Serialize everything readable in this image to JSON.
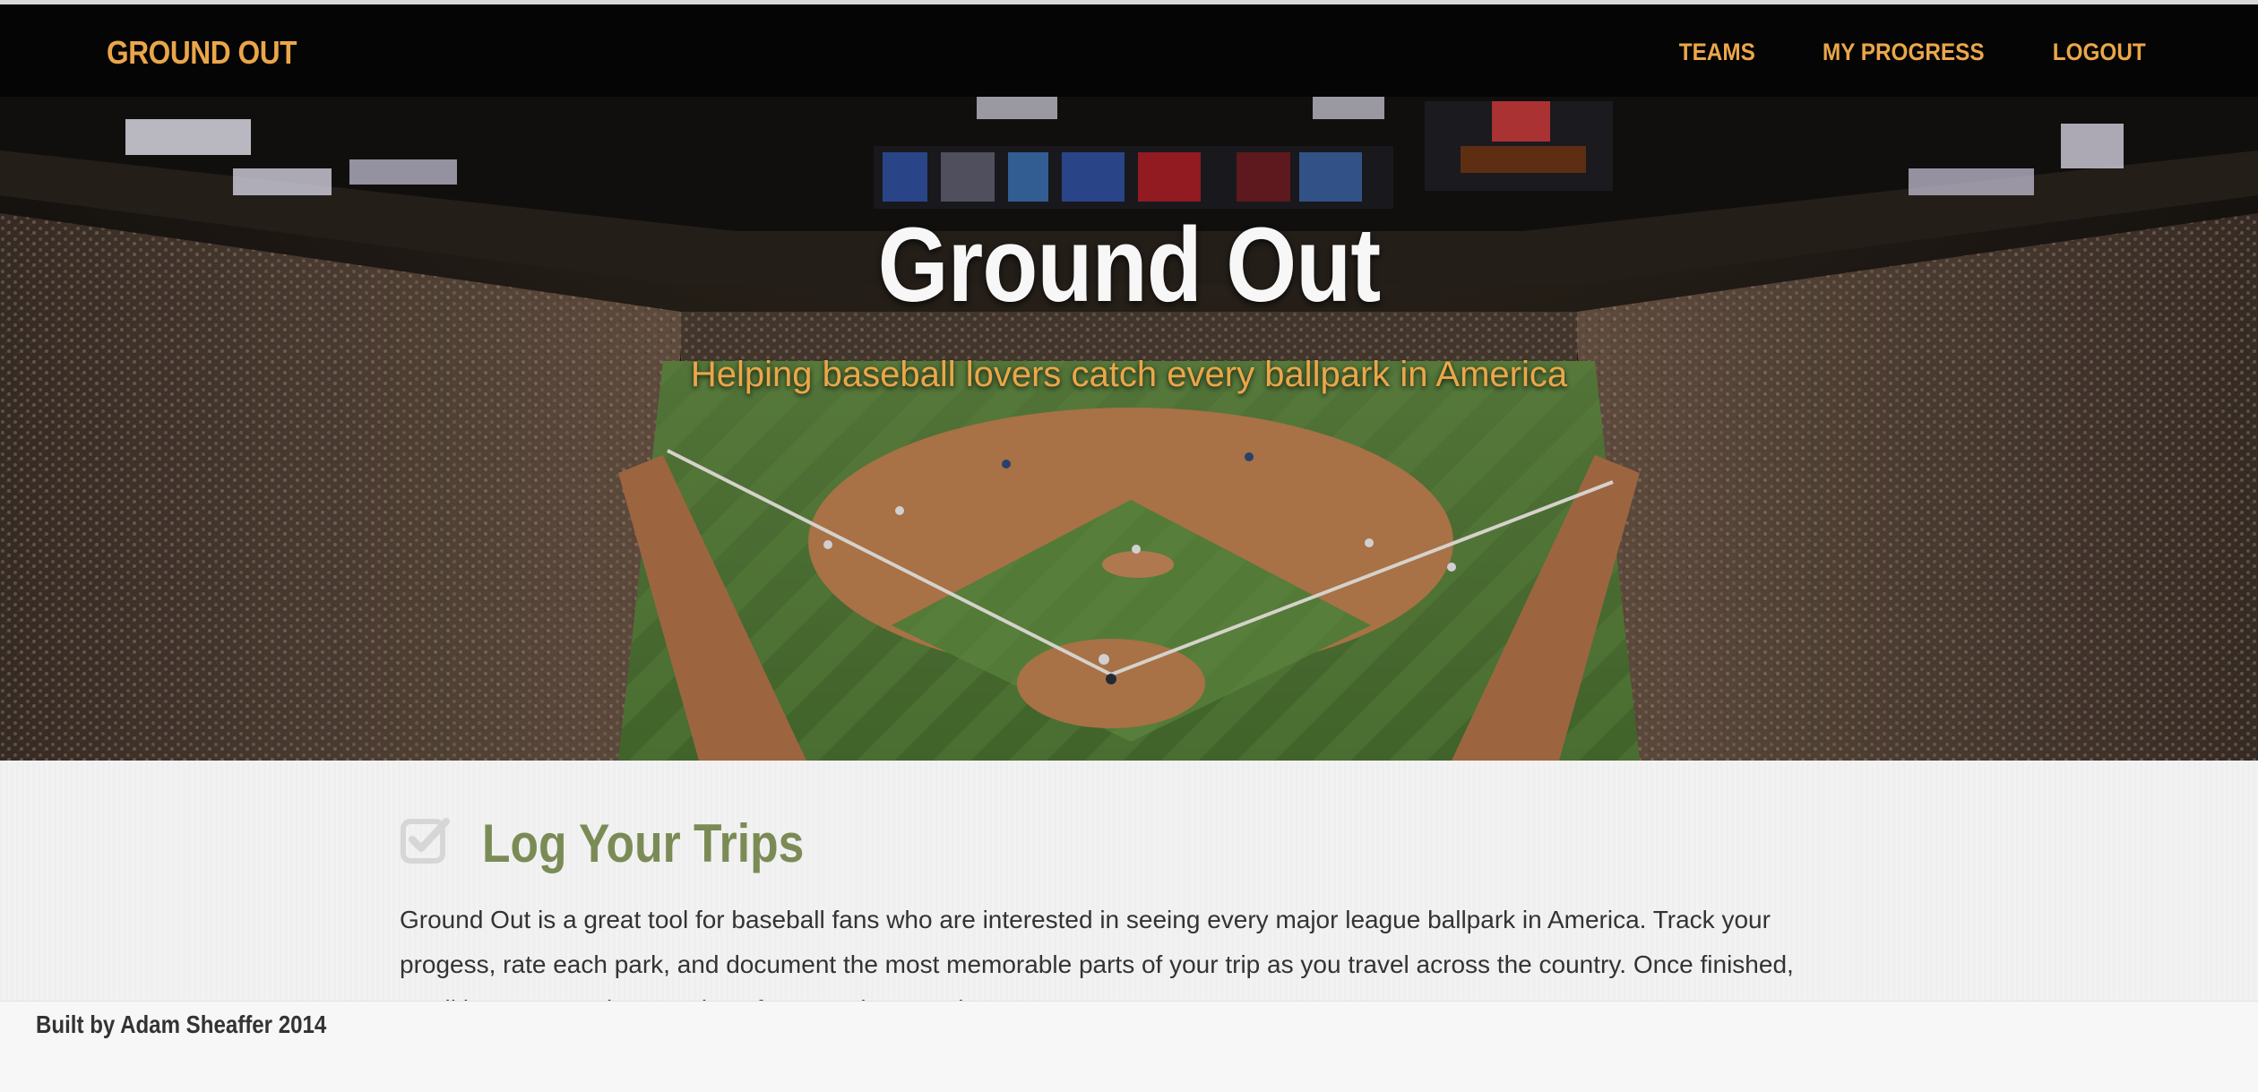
{
  "nav": {
    "brand": "GROUND OUT",
    "links": [
      "TEAMS",
      "MY PROGRESS",
      "LOGOUT"
    ]
  },
  "hero": {
    "title": "Ground Out",
    "subtitle": "Helping baseball lovers catch every ballpark in America",
    "image": "baseball-stadium-photo"
  },
  "section": {
    "icon": "check-square-icon",
    "title": "Log Your Trips",
    "body": "Ground Out is a great tool for baseball fans who are interested in seeing every major league ballpark in America. Track your progess, rate each park, and document the most memorable parts of your trip as you travel across the country. Once finished, you'll have a complete catalog of your entire experience."
  },
  "footer": {
    "text": "Built by Adam Sheaffer 2014"
  },
  "colors": {
    "accent": "#eba64a",
    "section_title": "#7b8b56",
    "navbar_bg": "#050505",
    "body_text": "#333333"
  }
}
